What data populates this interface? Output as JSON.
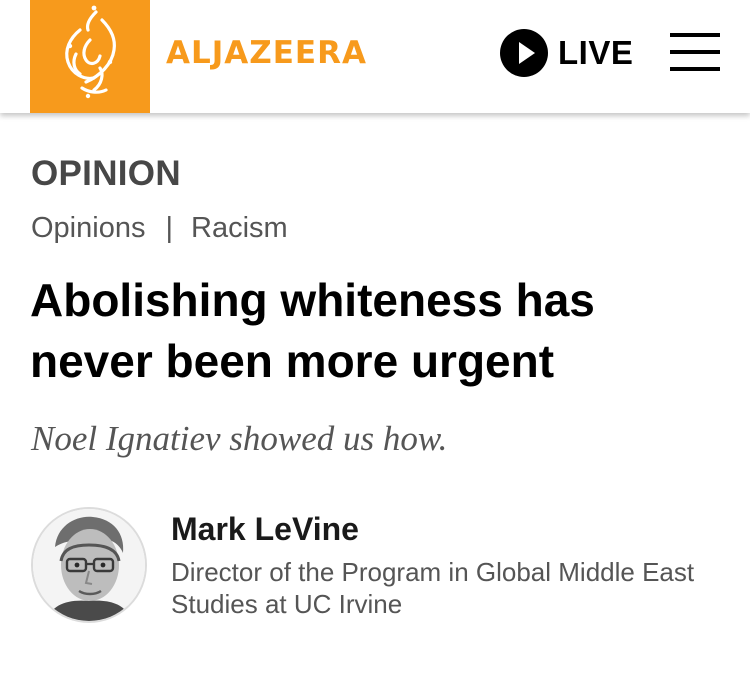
{
  "header": {
    "logo_wordmark": "ALJAZEERA",
    "live_label": "LIVE",
    "brand_color": "#f79a1c"
  },
  "article": {
    "section": "OPINION",
    "breadcrumb": [
      "Opinions",
      "Racism"
    ],
    "breadcrumb_separator": "|",
    "headline": "Abolishing whiteness has never been more urgent",
    "subheadline": "Noel Ignatiev showed us how."
  },
  "author": {
    "name": "Mark LeVine",
    "bio": "Director of the Program in Global Middle East Studies at UC Irvine"
  },
  "icons": {
    "logo": "al-jazeera-calligraphy-logo-icon",
    "live": "play-circle-icon",
    "menu": "hamburger-menu-icon"
  }
}
